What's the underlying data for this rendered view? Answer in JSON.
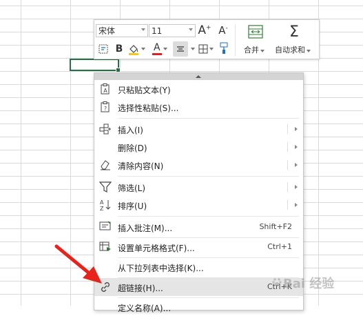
{
  "toolbar": {
    "font_name": "宋体",
    "font_size": "11",
    "grow_font": "A+",
    "shrink_font": "A-",
    "merge_label": "合并",
    "autosum_label": "自动求和",
    "bold": "B",
    "font_color_letter": "A",
    "accent_fill": "#f5c518",
    "accent_font": "#e02020"
  },
  "context_menu": {
    "items": [
      {
        "label": "只粘贴文本(Y)",
        "icon": "paste-text-icon",
        "shortcut": "",
        "submenu": false
      },
      {
        "label": "选择性粘贴(S)...",
        "icon": "paste-special-icon",
        "shortcut": "",
        "submenu": false
      },
      {
        "label": "插入(I)",
        "icon": "insert-cells-icon",
        "shortcut": "",
        "submenu": true
      },
      {
        "label": "删除(D)",
        "icon": "",
        "shortcut": "",
        "submenu": true
      },
      {
        "label": "清除内容(N)",
        "icon": "clear-eraser-icon",
        "shortcut": "",
        "submenu": true
      },
      {
        "label": "筛选(L)",
        "icon": "filter-funnel-icon",
        "shortcut": "",
        "submenu": true
      },
      {
        "label": "排序(U)",
        "icon": "sort-az-icon",
        "shortcut": "",
        "submenu": true
      },
      {
        "label": "插入批注(M)...",
        "icon": "comment-icon",
        "shortcut": "Shift+F2",
        "submenu": false
      },
      {
        "label": "设置单元格格式(F)...",
        "icon": "format-cells-icon",
        "shortcut": "Ctrl+1",
        "submenu": false
      },
      {
        "label": "从下拉列表中选择(K)...",
        "icon": "",
        "shortcut": "",
        "submenu": false
      },
      {
        "label": "超链接(H)...",
        "icon": "hyperlink-icon",
        "shortcut": "Ctrl+K",
        "submenu": false
      },
      {
        "label": "定义名称(A)...",
        "icon": "",
        "shortcut": "",
        "submenu": false
      }
    ]
  },
  "watermark": {
    "text": "Bai 经验"
  },
  "annotation_color": "#e8231c",
  "selection_color": "#217346"
}
